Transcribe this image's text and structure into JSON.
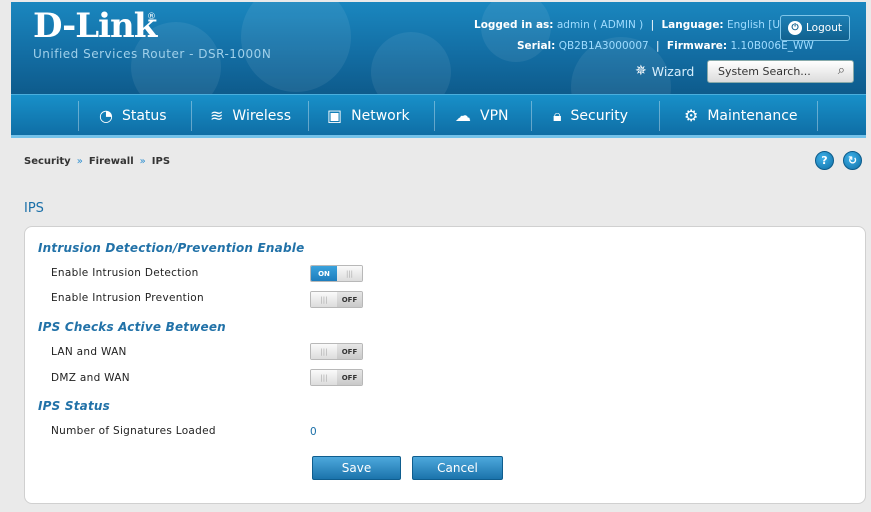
{
  "header": {
    "logo": "D-Link",
    "logo_reg": "®",
    "subtitle": "Unified Services Router - DSR-1000N",
    "logged_in_label": "Logged in as:",
    "logged_in_value": "admin ( ADMIN )",
    "separator": "|",
    "language_label": "Language:",
    "language_value": "English [US]",
    "serial_label": "Serial:",
    "serial_value": "QB2B1A3000007",
    "firmware_label": "Firmware:",
    "firmware_value": "1.10B006E_WW",
    "logout_label": "Logout",
    "logout_icon": "power-icon",
    "wizard_label": "Wizard",
    "wizard_icon": "wand-icon",
    "search_placeholder": "System Search...",
    "search_icon": "magnifier-icon"
  },
  "nav": {
    "items": [
      {
        "label": "Status",
        "icon": "gauge-icon"
      },
      {
        "label": "Wireless",
        "icon": "wifi-icon"
      },
      {
        "label": "Network",
        "icon": "monitor-icon"
      },
      {
        "label": "VPN",
        "icon": "cloud-lock-icon"
      },
      {
        "label": "Security",
        "icon": "padlock-icon"
      },
      {
        "label": "Maintenance",
        "icon": "gears-icon"
      }
    ]
  },
  "breadcrumb": {
    "items": [
      "Security",
      "Firewall",
      "IPS"
    ],
    "separator": "»"
  },
  "page_title": "IPS",
  "form": {
    "section1_title": "Intrusion Detection/Prevention Enable",
    "enable_detection_label": "Enable Intrusion Detection",
    "enable_detection_state": "ON",
    "enable_prevention_label": "Enable Intrusion Prevention",
    "enable_prevention_state": "OFF",
    "section2_title": "IPS Checks Active Between",
    "lan_wan_label": "LAN and WAN",
    "lan_wan_state": "OFF",
    "dmz_wan_label": "DMZ and WAN",
    "dmz_wan_state": "OFF",
    "section3_title": "IPS Status",
    "signatures_label": "Number of Signatures Loaded",
    "signatures_value": "0",
    "toggle_grip": "|||",
    "save_label": "Save",
    "cancel_label": "Cancel"
  },
  "colors": {
    "header_blue": "#136ea4",
    "nav_blue": "#1890c9",
    "accent": "#1a6fa8",
    "link_light": "#9fdcff"
  }
}
